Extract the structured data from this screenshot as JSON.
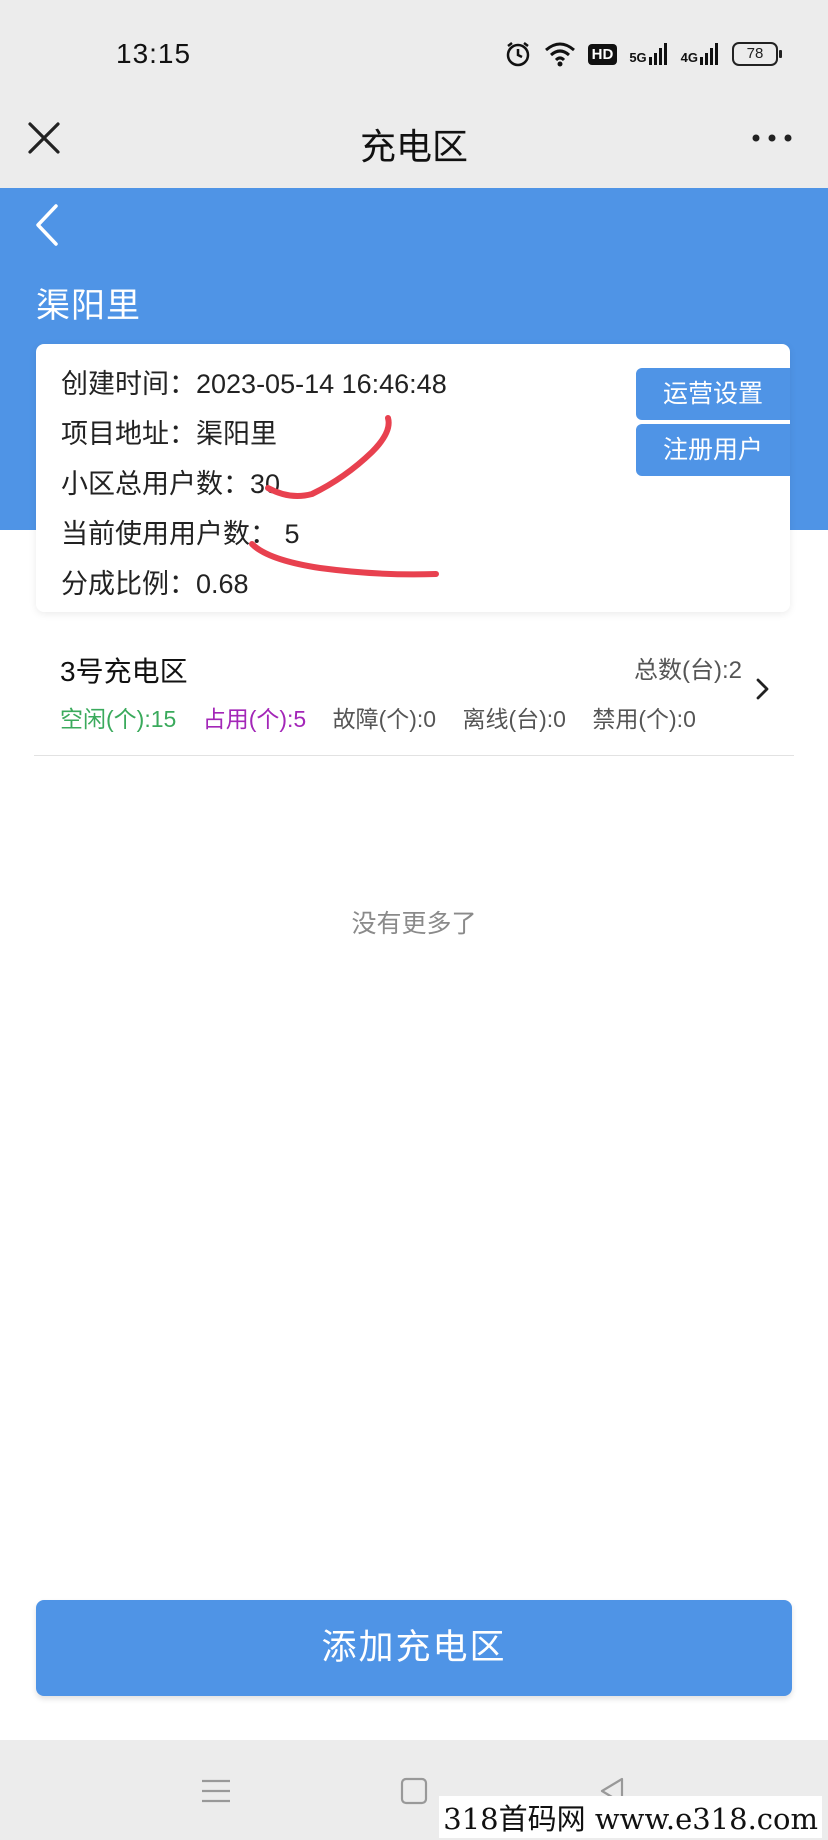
{
  "status_bar": {
    "time": "13:15",
    "hd_label": "HD",
    "net1": "5G",
    "net2": "4G",
    "battery": "78"
  },
  "title_bar": {
    "title": "充电区"
  },
  "hero": {
    "title": "渠阳里"
  },
  "info": {
    "created_label": "创建时间：",
    "created_value": "2023-05-14 16:46:48",
    "address_label": "项目地址：",
    "address_value": "渠阳里",
    "total_users_label": "小区总用户数：",
    "total_users_value": "30",
    "active_users_label": "当前使用用户数：",
    "active_users_value": "5",
    "ratio_label": "分成比例：",
    "ratio_value": "0.68",
    "btn_operation": "运营设置",
    "btn_register": "注册用户"
  },
  "zone": {
    "name": "3号充电区",
    "total": "总数(台):2",
    "stats": {
      "idle": "空闲(个):15",
      "occupied": "占用(个):5",
      "fault": "故障(个):0",
      "offline": "离线(台):0",
      "disabled": "禁用(个):0"
    }
  },
  "list_end": "没有更多了",
  "add_button": "添加充电区",
  "watermark": "318首码网  www.e318.com",
  "colors": {
    "primary": "#4f94e6",
    "idle": "#3aaa5c",
    "occupied": "#a326b8",
    "annotation": "#e8414f"
  },
  "icons": [
    "close-icon",
    "more-icon",
    "back-icon",
    "chevron-right-icon",
    "menu-icon",
    "home-icon",
    "back-triangle-icon",
    "alarm-icon",
    "wifi-icon",
    "signal-icon"
  ]
}
